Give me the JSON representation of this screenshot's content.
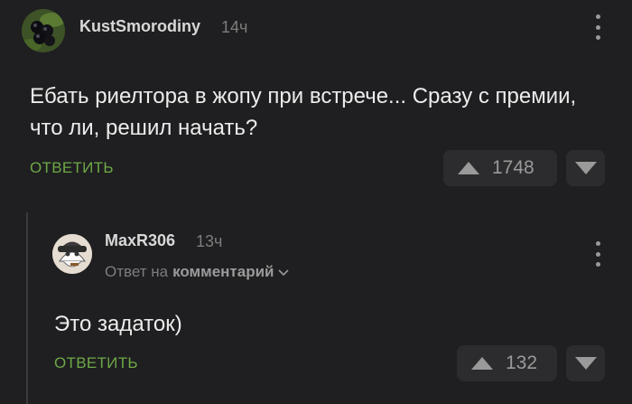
{
  "comments": [
    {
      "author": "KustSmorodiny",
      "time": "14ч",
      "text": "Ебать риелтора в жопу при встрече... Сразу с премии, что ли, решил начать?",
      "reply_label": "ОТВЕТИТЬ",
      "score": "1748"
    },
    {
      "author": "MaxR306",
      "time": "13ч",
      "reply_prefix": "Ответ на",
      "reply_target": "комментарий",
      "text": "Это задаток)",
      "reply_label": "ОТВЕТИТЬ",
      "score": "132"
    }
  ],
  "icons": {
    "upvote": "triangle-up-icon",
    "downvote": "triangle-down-icon",
    "menu": "kebab-menu-icon",
    "expand": "chevron-down-icon"
  },
  "colors": {
    "background": "#1f1f21",
    "accent_green": "#6da847",
    "button_bg": "#2c2c2e",
    "muted_text": "#7d7d7d"
  }
}
